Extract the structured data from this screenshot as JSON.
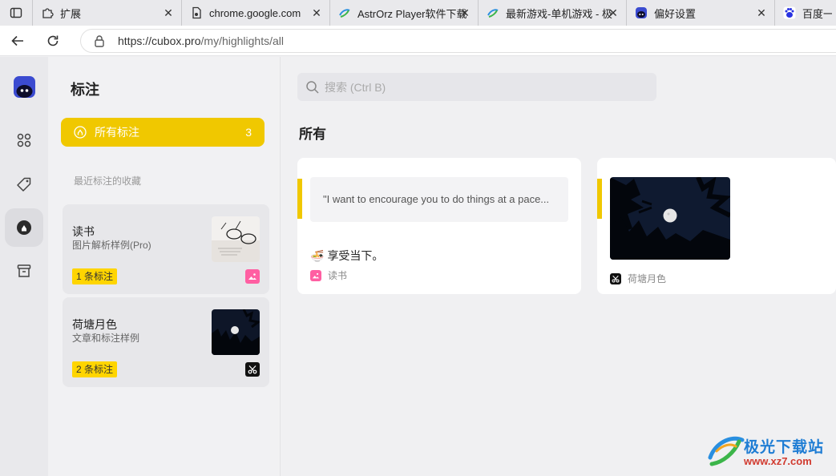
{
  "browser": {
    "tabs": [
      {
        "label": "扩展",
        "icon": "puzzle-icon"
      },
      {
        "label": "chrome.google.com",
        "icon": "page-icon"
      },
      {
        "label": "AstrOrz Player软件下载",
        "icon": "xz7-site-icon"
      },
      {
        "label": "最新游戏-单机游戏 - 极",
        "icon": "xz7-site-icon"
      },
      {
        "label": "偏好设置",
        "icon": "cubox-icon"
      },
      {
        "label": "百度一",
        "icon": "baidu-icon"
      }
    ],
    "url_host": "https://cubox.pro",
    "url_path": "/my/highlights/all"
  },
  "panel": {
    "title": "标注",
    "all_button": {
      "label": "所有标注",
      "count": "3"
    },
    "recent_label": "最近标注的收藏",
    "items": [
      {
        "title": "读书",
        "subtitle": "图片解析样例(Pro)",
        "badge": "1 条标注",
        "source_icon": "image-icon"
      },
      {
        "title": "荷塘月色",
        "subtitle": "文章和标注样例",
        "badge": "2 条标注",
        "source_icon": "scissors-icon"
      }
    ]
  },
  "main": {
    "search_placeholder": "搜索 (Ctrl B)",
    "section_title": "所有",
    "cards": [
      {
        "quote": "\"I want to encourage you to do things at a pace...",
        "note": "享受当下。",
        "source": "读书"
      },
      {
        "source": "荷塘月色"
      }
    ]
  },
  "watermark": {
    "title": "极光下载站",
    "url": "www.xz7.com"
  },
  "colors": {
    "accent": "#f0c800",
    "badge": "#ffd500",
    "cubox_brand": "#3b4bd0"
  }
}
